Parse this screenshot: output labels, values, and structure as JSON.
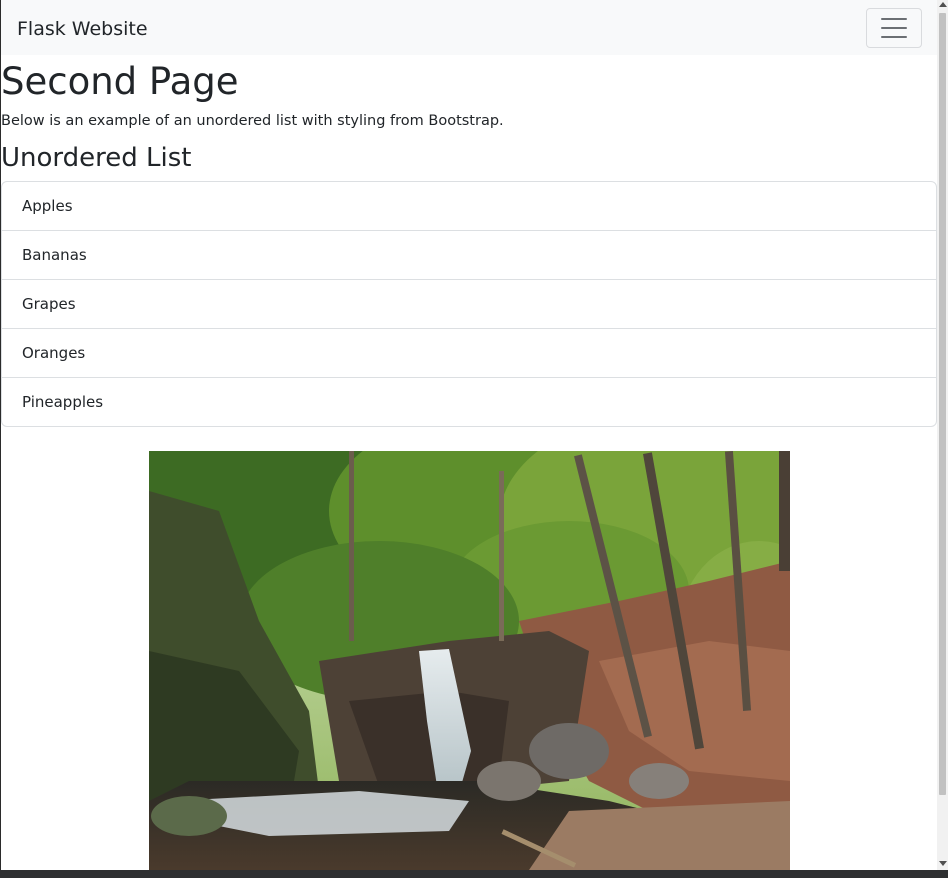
{
  "navbar": {
    "brand": "Flask Website",
    "toggler_icon": "hamburger-menu-icon"
  },
  "page": {
    "title": "Second Page",
    "description": "Below is an example of an unordered list with styling from Bootstrap.",
    "list_heading": "Unordered List"
  },
  "list": {
    "items": [
      "Apples",
      "Bananas",
      "Grapes",
      "Oranges",
      "Pineapples"
    ]
  },
  "image": {
    "subject": "waterfall-forest-photo"
  },
  "colors": {
    "navbar_bg": "#f8f9fa",
    "text": "#212529",
    "border": "#dcdfe2"
  }
}
